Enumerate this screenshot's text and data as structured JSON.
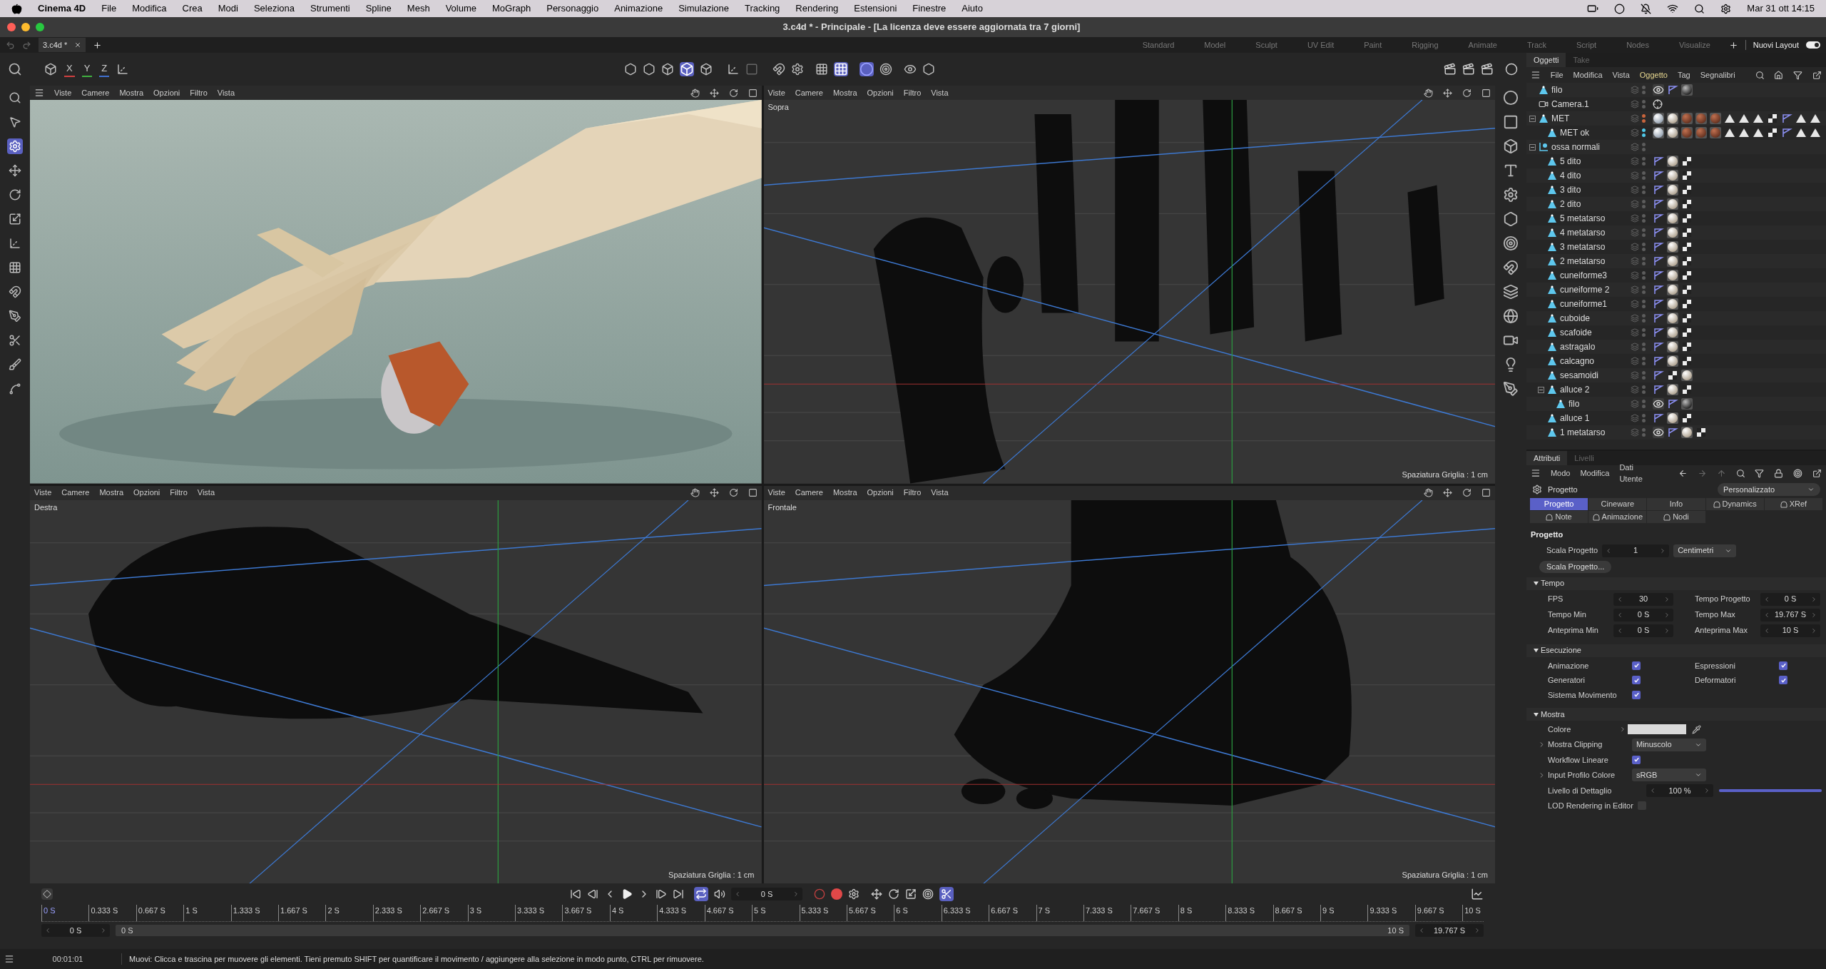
{
  "menubar": {
    "app": "Cinema 4D",
    "items": [
      "File",
      "Modifica",
      "Crea",
      "Modi",
      "Seleziona",
      "Strumenti",
      "Spline",
      "Mesh",
      "Volume",
      "MoGraph",
      "Personaggio",
      "Animazione",
      "Simulazione",
      "Tracking",
      "Rendering",
      "Estensioni",
      "Finestre",
      "Aiuto"
    ],
    "clock": "Mar 31 ott 14:15"
  },
  "window": {
    "title": "3.c4d * - Principale - [La licenza deve essere aggiornata tra 7 giorni]",
    "tab": "3.c4d *",
    "layouts": [
      "Standard",
      "Model",
      "Sculpt",
      "UV Edit",
      "Paint",
      "Rigging",
      "Animate",
      "Track",
      "Script",
      "Nodes",
      "Visualize"
    ],
    "current_layout": "Nuovi Layout",
    "layout_toggle_on": true
  },
  "toolbar": {
    "axes": [
      "X",
      "Y",
      "Z"
    ]
  },
  "tools": [
    {
      "selected": false
    },
    {
      "selected": false
    },
    {
      "selected": true
    },
    {
      "selected": false
    },
    {
      "selected": false
    },
    {
      "selected": false
    },
    {
      "selected": false
    },
    {
      "selected": false
    },
    {
      "selected": false
    },
    {
      "selected": false
    },
    {
      "selected": false
    },
    {
      "selected": false
    },
    {
      "selected": false
    }
  ],
  "viewports": [
    {
      "kind": "render",
      "menu": [
        "Viste",
        "Camere",
        "Mostra",
        "Opzioni",
        "Filtro",
        "Vista"
      ]
    },
    {
      "kind": "wireframe",
      "label": "Sopra",
      "grid": "Spaziatura Griglia : 1 cm",
      "menu": [
        "Viste",
        "Camere",
        "Mostra",
        "Opzioni",
        "Filtro",
        "Vista"
      ]
    },
    {
      "kind": "wireframe",
      "label": "Destra",
      "grid": "Spaziatura Griglia : 1 cm",
      "menu": [
        "Viste",
        "Camere",
        "Mostra",
        "Opzioni",
        "Filtro",
        "Vista"
      ]
    },
    {
      "kind": "wireframe",
      "label": "Frontale",
      "grid": "Spaziatura Griglia : 1 cm",
      "menu": [
        "Viste",
        "Camere",
        "Mostra",
        "Opzioni",
        "Filtro",
        "Vista"
      ]
    }
  ],
  "objects": {
    "tabs": [
      {
        "label": "Oggetti",
        "selected": true
      },
      {
        "label": "Take",
        "selected": false
      }
    ],
    "menu": [
      {
        "label": "File",
        "selected": false
      },
      {
        "label": "Modifica",
        "selected": false
      },
      {
        "label": "Vista",
        "selected": false
      },
      {
        "label": "Oggetto",
        "selected": true
      },
      {
        "label": "Tag",
        "selected": false
      },
      {
        "label": "Segnalibri",
        "selected": false
      }
    ],
    "rows": [
      {
        "name": "filo",
        "kind": "poly",
        "color": "#5c5c5c",
        "tags": [
          {
            "kind": "eye"
          },
          {
            "kind": "phong"
          },
          {
            "kind": "mat-dark"
          }
        ]
      },
      {
        "name": "Camera.1",
        "kind": "camera",
        "color": "#5c5c5c",
        "tags": [
          {
            "kind": "target"
          }
        ]
      },
      {
        "name": "MET",
        "kind": "poly",
        "color": "#c8643c",
        "tags": [
          {
            "kind": "mat-glass"
          },
          {
            "kind": "mat-white"
          },
          {
            "kind": "mat-rust"
          },
          {
            "kind": "mat-rust"
          },
          {
            "kind": "mat-rust"
          },
          {
            "kind": "sel"
          },
          {
            "kind": "sel"
          },
          {
            "kind": "sel"
          },
          {
            "kind": "checker"
          },
          {
            "kind": "phong"
          },
          {
            "kind": "sel"
          },
          {
            "kind": "sel"
          }
        ],
        "expanded": true,
        "children": [
          {
            "name": "MET ok",
            "kind": "poly",
            "color": "#4fc8e8",
            "tags": [
              {
                "kind": "mat-glass"
              },
              {
                "kind": "mat-white"
              },
              {
                "kind": "mat-rust"
              },
              {
                "kind": "mat-rust"
              },
              {
                "kind": "mat-rust"
              },
              {
                "kind": "sel"
              },
              {
                "kind": "sel"
              },
              {
                "kind": "sel"
              },
              {
                "kind": "checker"
              },
              {
                "kind": "phong"
              },
              {
                "kind": "sel"
              },
              {
                "kind": "sel"
              }
            ]
          }
        ]
      },
      {
        "name": "ossa normali",
        "kind": "null",
        "color": "#5c5c5c",
        "tags": [],
        "expanded": true,
        "children": [
          {
            "name": "5 dito",
            "kind": "poly",
            "color": "#5c5c5c",
            "tags": [
              {
                "kind": "phong"
              },
              {
                "kind": "mat-white"
              },
              {
                "kind": "checker"
              }
            ]
          },
          {
            "name": "4 dito",
            "kind": "poly",
            "color": "#5c5c5c",
            "tags": [
              {
                "kind": "phong"
              },
              {
                "kind": "mat-white"
              },
              {
                "kind": "checker"
              }
            ]
          },
          {
            "name": "3 dito",
            "kind": "poly",
            "color": "#5c5c5c",
            "tags": [
              {
                "kind": "phong"
              },
              {
                "kind": "mat-white"
              },
              {
                "kind": "checker"
              }
            ]
          },
          {
            "name": "2 dito",
            "kind": "poly",
            "color": "#5c5c5c",
            "tags": [
              {
                "kind": "phong"
              },
              {
                "kind": "mat-white"
              },
              {
                "kind": "checker"
              }
            ]
          },
          {
            "name": "5 metatarso",
            "kind": "poly",
            "color": "#5c5c5c",
            "tags": [
              {
                "kind": "phong"
              },
              {
                "kind": "mat-white"
              },
              {
                "kind": "checker"
              }
            ]
          },
          {
            "name": "4 metatarso",
            "kind": "poly",
            "color": "#5c5c5c",
            "tags": [
              {
                "kind": "phong"
              },
              {
                "kind": "mat-white"
              },
              {
                "kind": "checker"
              }
            ]
          },
          {
            "name": "3 metatarso",
            "kind": "poly",
            "color": "#5c5c5c",
            "tags": [
              {
                "kind": "phong"
              },
              {
                "kind": "mat-white"
              },
              {
                "kind": "checker"
              }
            ]
          },
          {
            "name": "2 metatarso",
            "kind": "poly",
            "color": "#5c5c5c",
            "tags": [
              {
                "kind": "phong"
              },
              {
                "kind": "mat-white"
              },
              {
                "kind": "checker"
              }
            ]
          },
          {
            "name": "cuneiforme3",
            "kind": "poly",
            "color": "#5c5c5c",
            "tags": [
              {
                "kind": "phong"
              },
              {
                "kind": "mat-white"
              },
              {
                "kind": "checker"
              }
            ]
          },
          {
            "name": "cuneiforme 2",
            "kind": "poly",
            "color": "#5c5c5c",
            "tags": [
              {
                "kind": "phong"
              },
              {
                "kind": "mat-white"
              },
              {
                "kind": "checker"
              }
            ]
          },
          {
            "name": "cuneiforme1",
            "kind": "poly",
            "color": "#5c5c5c",
            "tags": [
              {
                "kind": "phong"
              },
              {
                "kind": "mat-white"
              },
              {
                "kind": "checker"
              }
            ]
          },
          {
            "name": "cuboide",
            "kind": "poly",
            "color": "#5c5c5c",
            "tags": [
              {
                "kind": "phong"
              },
              {
                "kind": "mat-white"
              },
              {
                "kind": "checker"
              }
            ]
          },
          {
            "name": "scafoide",
            "kind": "poly",
            "color": "#5c5c5c",
            "tags": [
              {
                "kind": "phong"
              },
              {
                "kind": "mat-white"
              },
              {
                "kind": "checker"
              }
            ]
          },
          {
            "name": "astragalo",
            "kind": "poly",
            "color": "#5c5c5c",
            "tags": [
              {
                "kind": "phong"
              },
              {
                "kind": "mat-white"
              },
              {
                "kind": "checker"
              }
            ]
          },
          {
            "name": "calcagno",
            "kind": "poly",
            "color": "#5c5c5c",
            "tags": [
              {
                "kind": "phong"
              },
              {
                "kind": "mat-white"
              },
              {
                "kind": "checker"
              }
            ]
          },
          {
            "name": "sesamoidi",
            "kind": "poly",
            "color": "#5c5c5c",
            "tags": [
              {
                "kind": "phong"
              },
              {
                "kind": "checker"
              },
              {
                "kind": "mat-white"
              }
            ]
          },
          {
            "name": "alluce 2",
            "kind": "poly",
            "color": "#5c5c5c",
            "tags": [
              {
                "kind": "phong"
              },
              {
                "kind": "mat-white"
              },
              {
                "kind": "checker"
              }
            ],
            "expanded": true,
            "children": [
              {
                "name": "filo",
                "kind": "poly",
                "color": "#5c5c5c",
                "tags": [
                  {
                    "kind": "eye"
                  },
                  {
                    "kind": "phong"
                  },
                  {
                    "kind": "mat-dark"
                  }
                ]
              }
            ]
          },
          {
            "name": "alluce 1",
            "kind": "poly",
            "color": "#5c5c5c",
            "tags": [
              {
                "kind": "phong"
              },
              {
                "kind": "mat-white"
              },
              {
                "kind": "checker"
              }
            ]
          },
          {
            "name": "1 metatarso",
            "kind": "poly",
            "color": "#5c5c5c",
            "tags": [
              {
                "kind": "eye"
              },
              {
                "kind": "phong"
              },
              {
                "kind": "mat-white"
              },
              {
                "kind": "checker"
              }
            ]
          }
        ]
      }
    ]
  },
  "attributes": {
    "tabs": [
      {
        "label": "Attributi",
        "selected": true
      },
      {
        "label": "Livelli",
        "selected": false
      }
    ],
    "menu": [
      "Modo",
      "Modifica",
      "Dati Utente"
    ],
    "object": "Progetto",
    "preset": "Personalizzato",
    "subtabs": [
      {
        "label": "Progetto",
        "selected": true,
        "marked": false
      },
      {
        "label": "Cineware",
        "selected": false,
        "marked": false
      },
      {
        "label": "Info",
        "selected": false,
        "marked": false
      },
      {
        "label": "Dynamics",
        "selected": false,
        "marked": true
      },
      {
        "label": "XRef",
        "selected": false,
        "marked": true
      },
      {
        "label": "Note",
        "selected": false,
        "marked": true
      },
      {
        "label": "Animazione",
        "selected": false,
        "marked": true
      },
      {
        "label": "Nodi",
        "selected": false,
        "marked": true
      }
    ],
    "heading": "Progetto",
    "scale": {
      "label": "Scala Progetto",
      "value": "1",
      "unit": "Centimetri",
      "button": "Scala Progetto..."
    },
    "sections": [
      {
        "title": "Tempo",
        "expanded": true,
        "rows": [
          [
            {
              "kind": "number",
              "label": "FPS",
              "value": "30"
            },
            {
              "kind": "number",
              "label": "Tempo Progetto",
              "value": "0 S"
            }
          ],
          [
            {
              "kind": "number",
              "label": "Tempo Min",
              "value": "0 S"
            },
            {
              "kind": "number",
              "label": "Tempo Max",
              "value": "19.767 S"
            }
          ],
          [
            {
              "kind": "number",
              "label": "Anteprima Min",
              "value": "0 S"
            },
            {
              "kind": "number",
              "label": "Anteprima Max",
              "value": "10 S"
            }
          ]
        ]
      },
      {
        "title": "Esecuzione",
        "expanded": true,
        "rows": [
          [
            {
              "kind": "check",
              "label": "Animazione",
              "checked": true
            },
            {
              "kind": "check",
              "label": "Espressioni",
              "checked": true
            }
          ],
          [
            {
              "kind": "check",
              "label": "Generatori",
              "checked": true
            },
            {
              "kind": "check",
              "label": "Deformatori",
              "checked": true
            }
          ],
          [
            {
              "kind": "check",
              "label": "Sistema Movimento",
              "checked": true
            }
          ]
        ]
      },
      {
        "title": "Mostra",
        "expanded": true,
        "rows": [
          [
            {
              "kind": "color",
              "label": "Colore",
              "color": "#d9d9d9"
            }
          ],
          [
            {
              "kind": "dropdown",
              "label": "Mostra Clipping",
              "value": "Minuscolo",
              "expandable": true
            }
          ],
          [
            {
              "kind": "check",
              "label": "Workflow Lineare",
              "checked": true
            }
          ],
          [
            {
              "kind": "dropdown",
              "label": "Input Profilo Colore",
              "value": "sRGB",
              "expandable": true
            }
          ],
          [
            {
              "kind": "slider",
              "label": "Livello di Dettaglio",
              "value": "100 %",
              "level": 1
            }
          ],
          [
            {
              "kind": "check",
              "label": "LOD Rendering in Editor",
              "checked": false
            }
          ]
        ]
      }
    ]
  },
  "timeline": {
    "time": "0 S",
    "ticks": [
      "0 S",
      "0.333 S",
      "0.667 S",
      "1 S",
      "1.333 S",
      "1.667 S",
      "2 S",
      "2.333 S",
      "2.667 S",
      "3 S",
      "3.333 S",
      "3.667 S",
      "4 S",
      "4.333 S",
      "4.667 S",
      "5 S",
      "5.333 S",
      "5.667 S",
      "6 S",
      "6.333 S",
      "6.667 S",
      "7 S",
      "7.333 S",
      "7.667 S",
      "8 S",
      "8.333 S",
      "8.667 S",
      "9 S",
      "9.333 S",
      "9.667 S",
      "10 S"
    ],
    "start": "0 S",
    "range_start": "0 S",
    "range_end": "10 S",
    "end": "19.767 S"
  },
  "status": {
    "time": "00:01:01",
    "message": "Muovi: Clicca e trascina per muovere gli elementi. Tieni premuto SHIFT per quantificare il movimento / aggiungere alla selezione in modo punto, CTRL per rimuovere."
  }
}
